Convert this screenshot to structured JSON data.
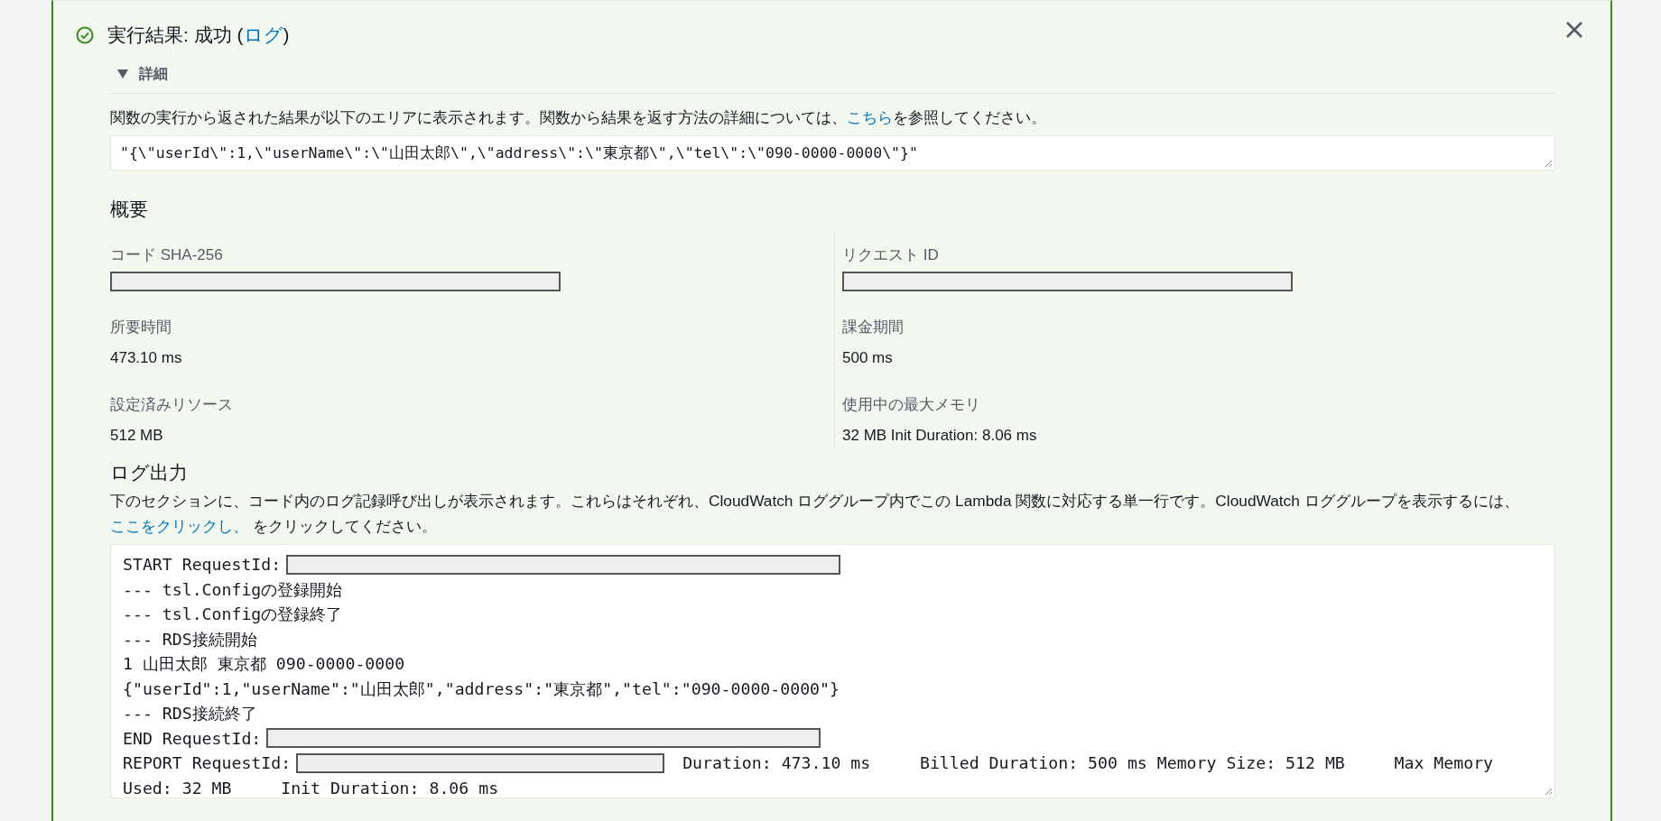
{
  "result": {
    "succeeded": true,
    "title": "実行結果: 成功 (",
    "link": "ログ",
    "title_end": ")",
    "closable": true
  },
  "details": {
    "label": "詳細",
    "expanded": true,
    "description_before": "関数の実行から返された結果が以下のエリアに表示されます。関数から結果を返す方法の詳細については、",
    "description_link": "こちら",
    "description_after": "を参照してください。",
    "output": "\"{\\\"userId\\\":1,\\\"userName\\\":\\\"山田太郎\\\",\\\"address\\\":\\\"東京都\\\",\\\"tel\\\":\\\"090-0000-0000\\\"}\""
  },
  "summary": {
    "heading": "概要",
    "fields": [
      {
        "label": "コード SHA-256",
        "redacted": true
      },
      {
        "label": "リクエスト ID",
        "redacted": true
      },
      {
        "label": "所要時間",
        "value": "473.10 ms"
      },
      {
        "label": "課金期間",
        "value": "500 ms"
      },
      {
        "label": "設定済みリソース",
        "value": "512 MB"
      },
      {
        "label": "使用中の最大メモリ",
        "value": "32 MB Init Duration: 8.06 ms"
      }
    ]
  },
  "log_output": {
    "heading": "ログ出力",
    "description_before": "下のセクションに、コード内のログ記録呼び出しが表示されます。これらはそれぞれ、CloudWatch ロググループ内でこの Lambda 関数に対応する単一行です。CloudWatch ロググループを表示するには、",
    "description_link": "ここをクリックし、",
    "description_after": " をクリックしてください。",
    "lines": [
      {
        "text": "START RequestId:",
        "redacted": true
      },
      {
        "text": "--- tsl.Configの登録開始"
      },
      {
        "text": "--- tsl.Configの登録終了"
      },
      {
        "text": "--- RDS接続開始"
      },
      {
        "text": "1 山田太郎 東京都 090-0000-0000"
      },
      {
        "text": "{\"userId\":1,\"userName\":\"山田太郎\",\"address\":\"東京都\",\"tel\":\"090-0000-0000\"}"
      },
      {
        "text": "--- RDS接続終了"
      },
      {
        "text": "END RequestId:",
        "redacted": true
      },
      {
        "text": "REPORT RequestId:",
        "redacted": true,
        "after": "Duration: 473.10 ms     Billed Duration: 500 ms Memory Size: 512 MB     Max Memory"
      },
      {
        "text": "Used: 32 MB     Init Duration: 8.06 ms"
      }
    ]
  }
}
